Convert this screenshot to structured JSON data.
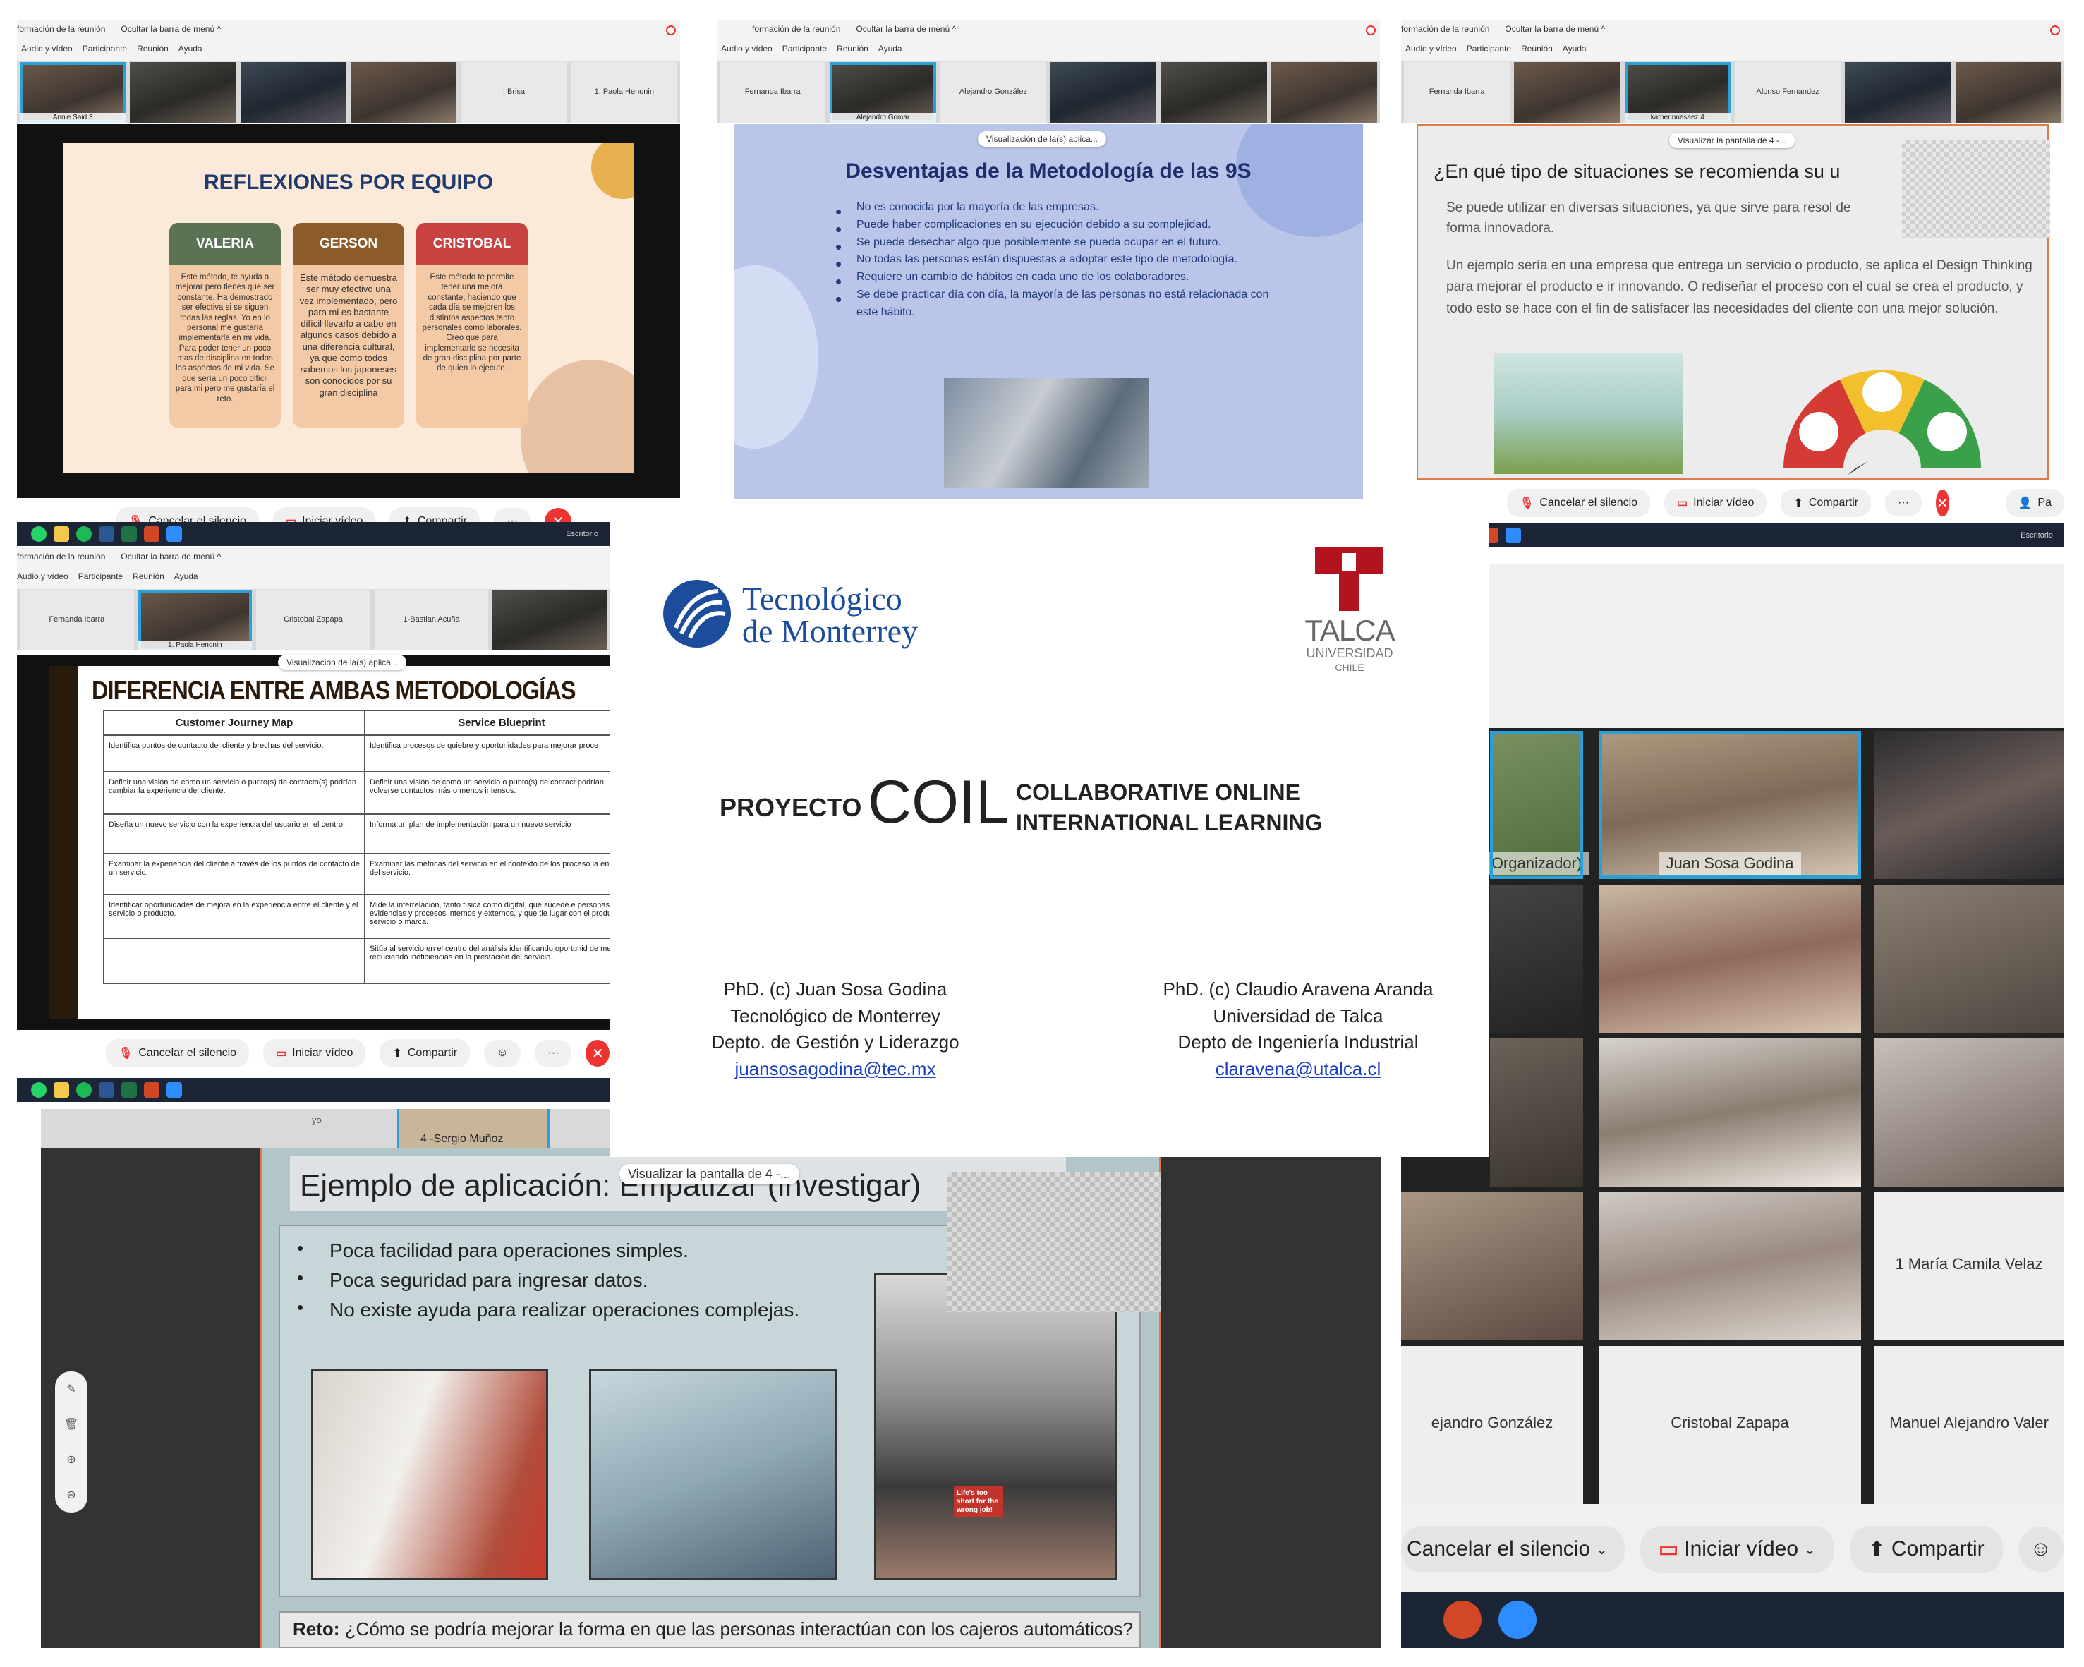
{
  "common": {
    "menu_bar": {
      "info_label": "formación de la reunión",
      "hide_label": "Ocultar la barra de menú ^",
      "audio_label": "Audio y vídeo",
      "participant_label": "Participante",
      "meeting_label": "Reunión",
      "help_label": "Ayuda"
    },
    "controls": {
      "mute_label": "Cancelar el silencio",
      "video_label": "Iniciar vídeo",
      "share_label": "Compartir",
      "more_label": "···",
      "end_label": "✕"
    },
    "taskbar_desktop_label": "Escritorio",
    "visualization_label": "Visualización de la(s) aplica...",
    "view_screen_label": "Visualizar la pantalla de 4 -..."
  },
  "panel1": {
    "participants": [
      "Annie Said 3",
      "",
      "",
      "",
      "! Brisa",
      "1. Paola Henonin"
    ],
    "slide": {
      "title": "REFLEXIONES POR EQUIPO",
      "cards": [
        {
          "name": "VALERIA",
          "color": "#5b7355",
          "text": "Este método, te ayuda a mejorar pero tienes que ser constante. Ha demostrado ser efectiva si se siguen todas las reglas. Yo en lo personal me gustaría implementarla en mi vida. Para poder tener un poco mas de disciplina en todos los aspectos de mi vida. Se que sería un poco difícil para mi pero me gustaría el reto."
        },
        {
          "name": "GERSON",
          "color": "#8c5b2a",
          "text": "Este método demuestra ser muy efectivo una vez implementado, pero para mi es bastante difícil llevarlo a cabo en algunos casos debido a una diferencia cultural, ya que como todos sabemos los japoneses son conocidos por su gran disciplina"
        },
        {
          "name": "CRISTOBAL",
          "color": "#c94242",
          "text": "Este método te permite tener una mejora constante, haciendo que cada día se mejoren los distintos aspectos tanto personales como laborales. Creo que para implementarlo se necesita de gran disciplina por parte de quien lo ejecute."
        }
      ]
    }
  },
  "panel2": {
    "participants": [
      "Fernanda Ibarra",
      "Alejandro Gomar",
      "Alejandro González",
      "",
      "",
      ""
    ],
    "slide": {
      "title": "Desventajas de la Metodología de las 9S",
      "bullets": [
        "No es conocida por la mayoría de las empresas.",
        "Puede haber complicaciones en su ejecución debido a su complejidad.",
        "Se puede desechar algo que posiblemente se pueda ocupar en el futuro.",
        "No todas las personas están dispuestas a adoptar este tipo de metodología.",
        "Requiere un cambio de hábitos en cada uno de los colaboradores.",
        "Se debe practicar día con día, la mayoría de las personas no está relacionada con este hábito."
      ]
    }
  },
  "panel3": {
    "participants": [
      "Fernanda Ibarra",
      "",
      "katherinnesaez 4",
      "Alonso Fernandez",
      "",
      ""
    ],
    "slide": {
      "title": "¿En qué tipo de situaciones se recomienda su u",
      "paragraphs": [
        "Se puede utilizar en diversas situaciones, ya que sirve para resol de forma innovadora.",
        "Un ejemplo sería en una empresa que entrega un servicio o producto, se aplica el Design Thinking para mejorar el producto e ir innovando. O rediseñar el proceso con el cual se crea el producto, y todo esto se hace con el fin de satisfacer las necesidades del cliente con una mejor solución."
      ]
    },
    "partial_label": "Pa"
  },
  "panel4": {
    "participants": [
      "Fernanda Ibarra",
      "1. Paola Henonin",
      "Cristobal Zapapa",
      "1-Bastian Acuña",
      ""
    ],
    "slide": {
      "title": "DIFERENCIA ENTRE AMBAS METODOLOGÍAS",
      "col1": "Customer Journey Map",
      "col2": "Service Blueprint",
      "rows": [
        [
          "Identifica puntos de contacto del cliente y brechas del servicio.",
          "Identifica procesos de quiebre y oportunidades para mejorar proce"
        ],
        [
          "Definir una visión de como un servicio o punto(s) de contacto(s) podrían cambiar la experiencia del cliente.",
          "Definir una visión de como un servicio o punto(s) de contact podrían volverse contactos más o menos intensos."
        ],
        [
          "Diseña un nuevo servicio con la experiencia del usuario en el centro.",
          "Informa un plan de implementación para un nuevo servicio"
        ],
        [
          "Examinar la experiencia del cliente a través de los puntos de contacto de un servicio.",
          "Examinar las métricas del servicio en el contexto de los proceso la entrega del servicio."
        ],
        [
          "Identificar oportunidades de mejora en la experiencia entre el cliente y el servicio o producto.",
          "Mide la interrelación, tanto física como digital, que sucede e personas, evidencias y procesos internos y externos, y que tie lugar con el producto, servicio o marca."
        ],
        [
          "",
          "Sitúa al servicio en el centro del análisis identificando oportunid de mejora y reduciendo ineficiencias en la prestación del servicio."
        ]
      ]
    }
  },
  "panel5": {
    "top_labels": [
      "yo",
      "4 -Sergio Muñoz"
    ],
    "slide": {
      "title": "Ejemplo de aplicación: Empatizar (investigar)",
      "bullets": [
        "Poca facilidad para operaciones simples.",
        "Poca seguridad para ingresar datos.",
        "No existe ayuda para realizar operaciones complejas."
      ],
      "poster_text": "Life's too short for the wrong job!",
      "challenge_label": "Reto:",
      "challenge_text": "¿Cómo se podría mejorar la forma en que las personas interactúan con los cajeros automáticos?"
    }
  },
  "panel6": {
    "tiles": [
      "Organizador)",
      "Juan Sosa Godina",
      "",
      "",
      "",
      "",
      "",
      "",
      "",
      "",
      "",
      "1 María Camila Velaz",
      "ejandro González",
      "Cristobal Zapapa",
      "Manuel Alejandro Valer"
    ]
  },
  "center": {
    "tec_line1": "Tecnológico",
    "tec_line2": "de Monterrey",
    "talca_name": "TALCA",
    "talca_sub": "UNIVERSIDAD",
    "talca_country": "CHILE",
    "proyecto": "PROYECTO",
    "coil": "COIL",
    "coil_line1": "COLLABORATIVE ONLINE",
    "coil_line2": "INTERNATIONAL  LEARNING",
    "author1": [
      "PhD. (c) Juan Sosa Godina",
      "Tecnológico de Monterrey",
      "Depto. de Gestión y Liderazgo",
      "juansosagodina@tec.mx"
    ],
    "author2": [
      "PhD. (c) Claudio Aravena Aranda",
      "Universidad de Talca",
      "Depto de Ingeniería Industrial",
      "claravena@utalca.cl"
    ]
  }
}
